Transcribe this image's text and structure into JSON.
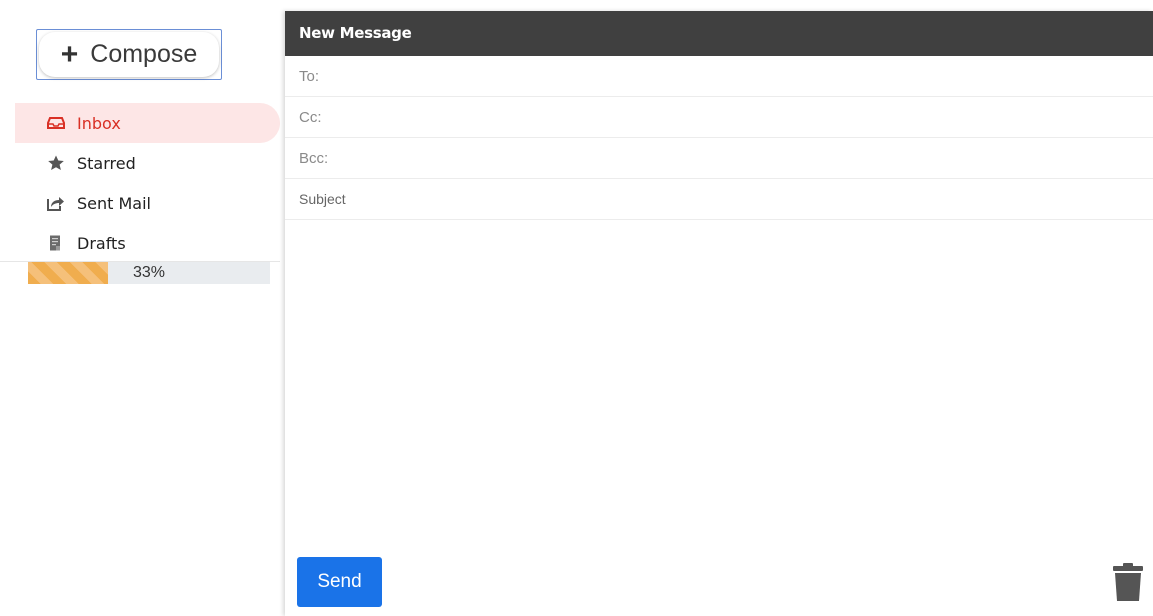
{
  "sidebar": {
    "compose_label": "Compose",
    "items": [
      {
        "label": "Inbox",
        "icon": "inbox-icon",
        "active": true
      },
      {
        "label": "Starred",
        "icon": "star-icon",
        "active": false
      },
      {
        "label": "Sent Mail",
        "icon": "sent-icon",
        "active": false
      },
      {
        "label": "Drafts",
        "icon": "drafts-icon",
        "active": false
      }
    ],
    "storage": {
      "percent_label": "33%",
      "fraction": 0.33
    }
  },
  "message": {
    "title": "New Message",
    "to_placeholder": "To:",
    "cc_placeholder": "Cc:",
    "bcc_placeholder": "Bcc:",
    "subject_placeholder": "Subject",
    "send_label": "Send"
  },
  "colors": {
    "accent": "#1a73e8",
    "active_text": "#d93025",
    "active_bg": "#fde6e6",
    "header_bg": "#404040",
    "progress": "#f0ad4e"
  }
}
